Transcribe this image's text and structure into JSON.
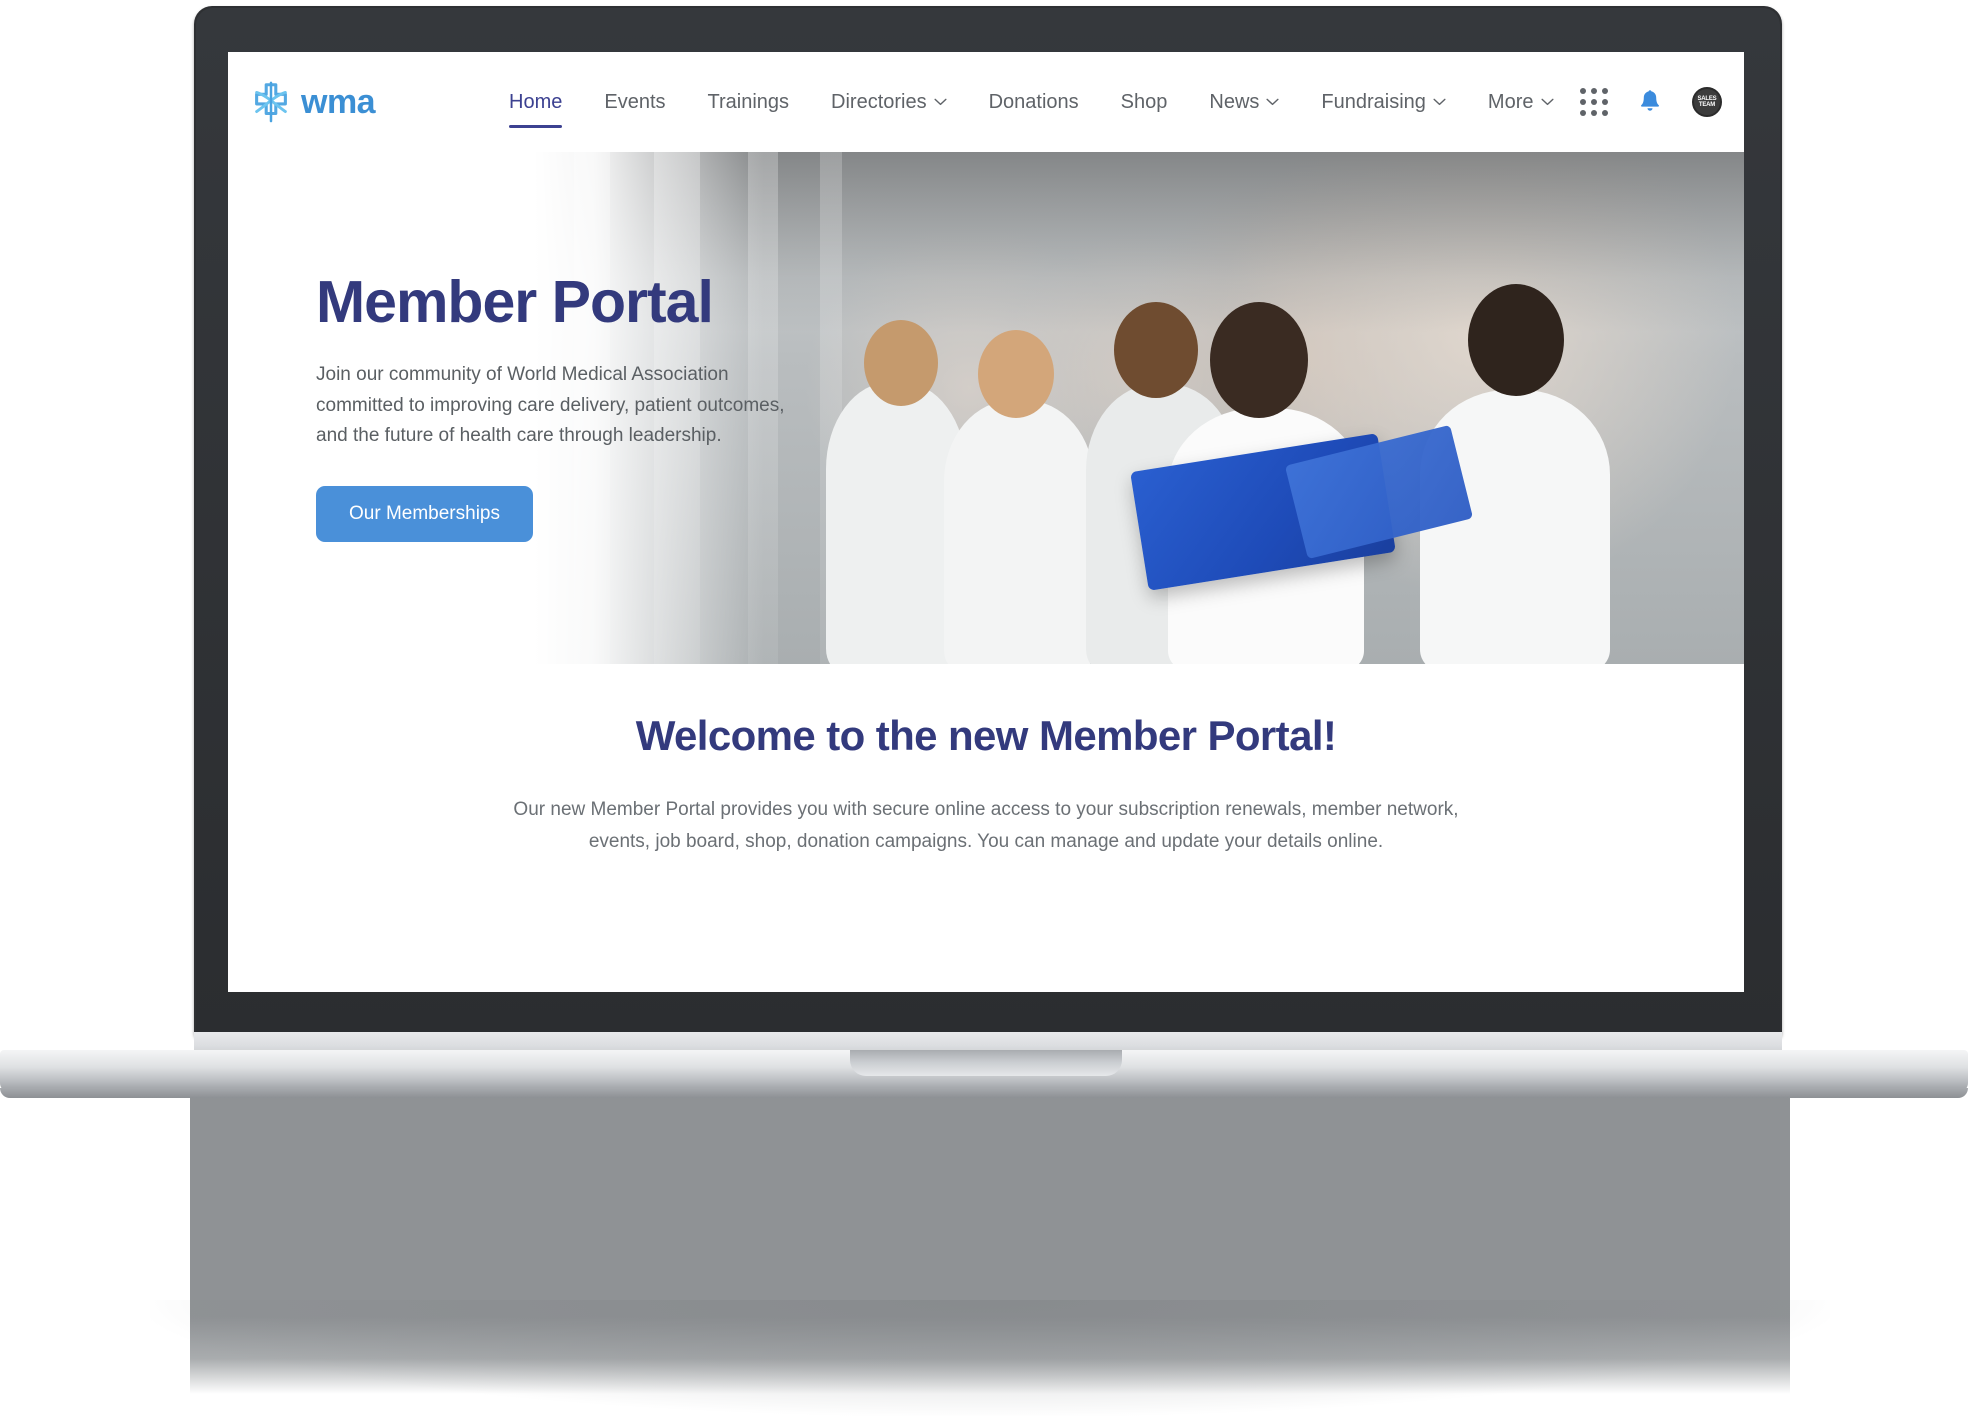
{
  "header": {
    "brand": {
      "name": "wma",
      "logo_icon": "wma-cross-logo-icon",
      "color": "#3b8fd4"
    },
    "nav": [
      {
        "label": "Home",
        "active": true,
        "has_caret": false
      },
      {
        "label": "Events",
        "active": false,
        "has_caret": false
      },
      {
        "label": "Trainings",
        "active": false,
        "has_caret": false
      },
      {
        "label": "Directories",
        "active": false,
        "has_caret": true
      },
      {
        "label": "Donations",
        "active": false,
        "has_caret": false
      },
      {
        "label": "Shop",
        "active": false,
        "has_caret": false
      },
      {
        "label": "News",
        "active": false,
        "has_caret": true
      },
      {
        "label": "Fundraising",
        "active": false,
        "has_caret": true
      },
      {
        "label": "More",
        "active": false,
        "has_caret": true
      }
    ],
    "actions": {
      "apps_icon": "apps-grid-icon",
      "notifications_icon": "bell-icon",
      "avatar_label": "SALES TEAM"
    }
  },
  "hero": {
    "title": "Member Portal",
    "subtitle": "Join our community of World Medical Association committed to improving care delivery, patient outcomes, and the future of health care through leadership.",
    "cta_label": "Our Memberships",
    "cta_color": "#4a90d9",
    "image_alt": "Medical professionals in white coats in a hospital corridor"
  },
  "welcome": {
    "title": "Welcome to the new Member Portal!",
    "body": "Our new Member Portal provides you with secure online access to your subscription renewals, member network, events, job board, shop, donation campaigns. You can manage and update your details online."
  },
  "theme": {
    "navy": "#333a7d",
    "blue": "#4a90d9",
    "brand_blue": "#3b8fd4",
    "muted_text": "#5f6368"
  }
}
